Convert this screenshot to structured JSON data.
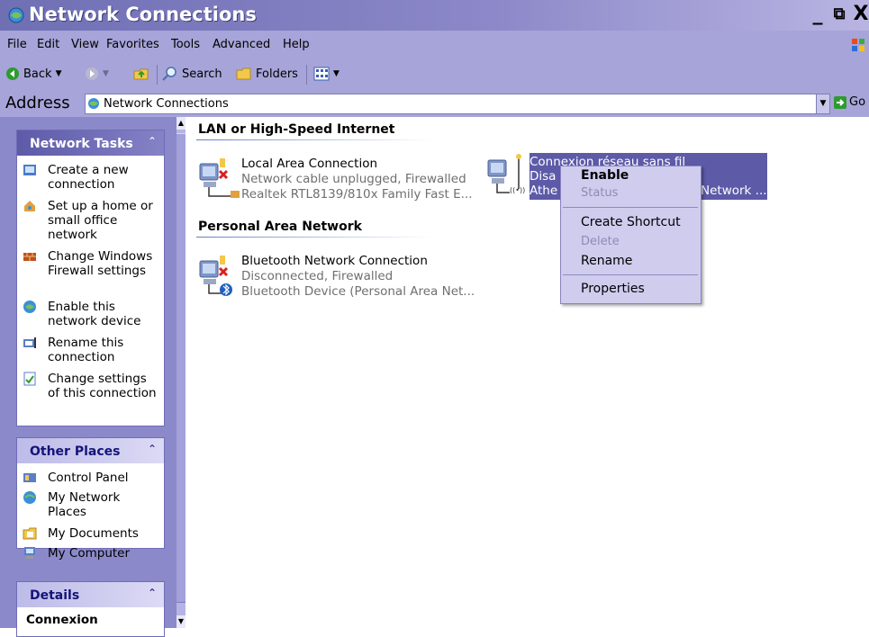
{
  "window": {
    "title": "Network Connections",
    "minimize": "_",
    "restore": "⧉",
    "close": "X"
  },
  "menu": [
    "File",
    "Edit",
    "View",
    "Favorites",
    "Tools",
    "Advanced",
    "Help"
  ],
  "toolbar": {
    "back": "Back",
    "search": "Search",
    "folders": "Folders"
  },
  "address": {
    "label": "Address",
    "value": "Network Connections",
    "go": "Go"
  },
  "left_pane": {
    "network_tasks": {
      "title": "Network Tasks",
      "items": [
        "Create a new connection",
        "Set up a home or small office network",
        "Change Windows Firewall settings",
        "Enable this network device",
        "Rename this connection",
        "Change settings of this connection"
      ]
    },
    "other_places": {
      "title": "Other Places",
      "items": [
        "Control Panel",
        "My Network Places",
        "My Documents",
        "My Computer"
      ]
    },
    "details": {
      "title": "Details",
      "text": "Connexion"
    }
  },
  "content": {
    "groups": [
      {
        "title": "LAN or High-Speed Internet",
        "connections": [
          {
            "name": "Local Area Connection",
            "status": "Network cable unplugged, Firewalled",
            "device": "Realtek RTL8139/810x Family Fast E..."
          },
          {
            "name": "Connexion réseau sans fil",
            "status": "Disa",
            "device": "Athe",
            "device_tail": "Network ..."
          }
        ]
      },
      {
        "title": "Personal Area Network",
        "connections": [
          {
            "name": "Bluetooth Network Connection",
            "status": "Disconnected, Firewalled",
            "device": "Bluetooth Device (Personal Area Net..."
          }
        ]
      }
    ]
  },
  "context_menu": {
    "items": [
      {
        "label": "Enable",
        "style": "bold"
      },
      {
        "label": "Status",
        "style": "disabled"
      },
      {
        "label": "Create Shortcut",
        "style": "normal"
      },
      {
        "label": "Delete",
        "style": "disabled"
      },
      {
        "label": "Rename",
        "style": "normal"
      },
      {
        "label": "Properties",
        "style": "normal"
      }
    ]
  },
  "colors": {
    "title_bar": "#6f6fb4",
    "chrome": "#a6a4d8",
    "selection": "#5d5aa8",
    "menu_bg": "#cfccee"
  }
}
